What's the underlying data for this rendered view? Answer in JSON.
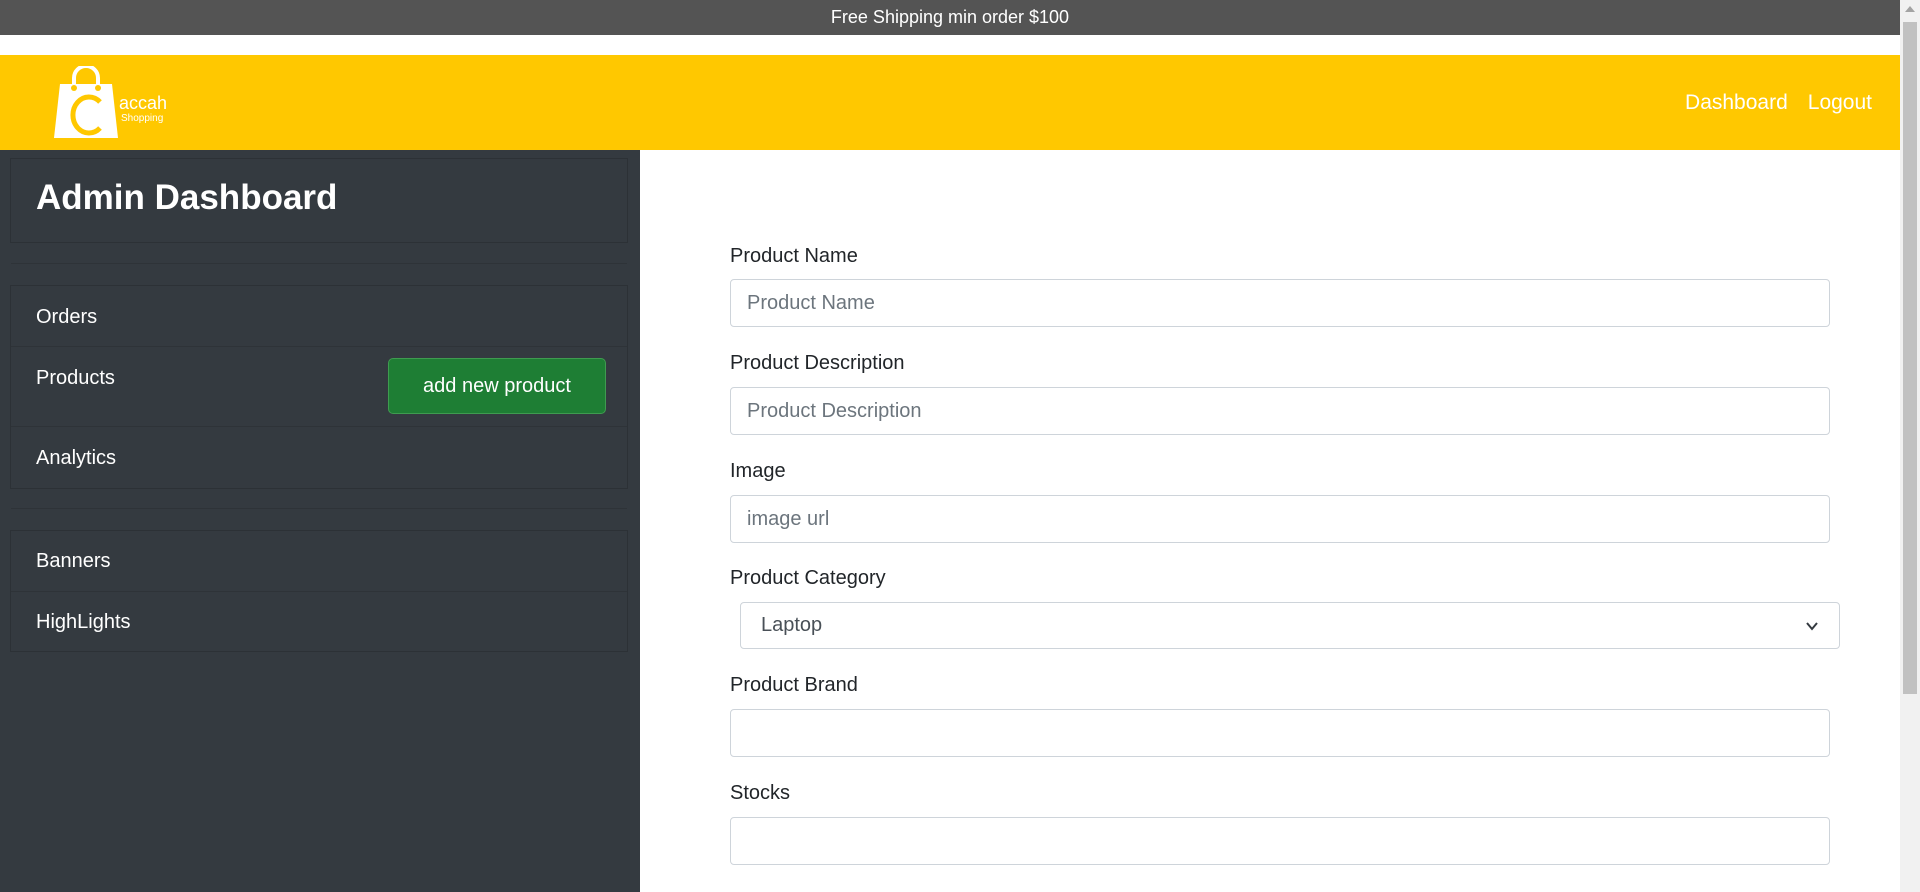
{
  "announcement": "Free Shipping min order $100",
  "brand": {
    "name": "accah",
    "tagline": "Shopping"
  },
  "nav": {
    "dashboard": "Dashboard",
    "logout": "Logout"
  },
  "sidebar": {
    "title": "Admin Dashboard",
    "items": [
      "Orders",
      "Products",
      "Analytics",
      "Banners",
      "HighLights"
    ],
    "add_button": "add new product"
  },
  "form": {
    "product_name": {
      "label": "Product Name",
      "placeholder": "Product Name",
      "value": ""
    },
    "product_description": {
      "label": "Product Description",
      "placeholder": "Product Description",
      "value": ""
    },
    "image": {
      "label": "Image",
      "placeholder": "image url",
      "value": ""
    },
    "product_category": {
      "label": "Product Category",
      "selected": "Laptop"
    },
    "product_brand": {
      "label": "Product Brand",
      "value": ""
    },
    "stocks": {
      "label": "Stocks",
      "value": ""
    }
  },
  "colors": {
    "announcement_bg": "#545454",
    "navbar_bg": "#ffc800",
    "sidebar_bg": "#343a40",
    "button_bg": "#1e7e34"
  }
}
